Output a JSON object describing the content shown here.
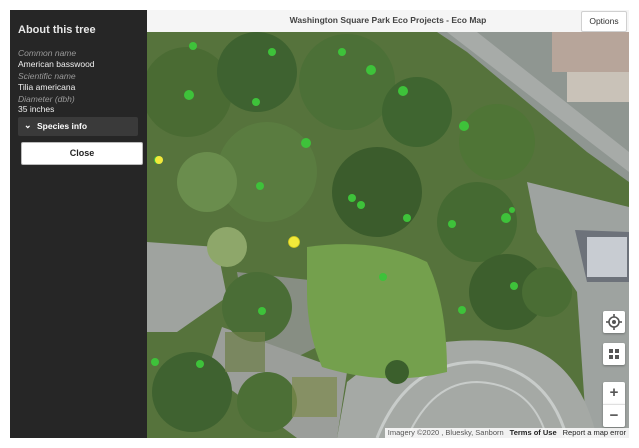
{
  "header": {
    "title": "Washington Square Park Eco Projects - Eco Map",
    "options_label": "Options"
  },
  "sidebar": {
    "title": "About this tree",
    "fields": [
      {
        "label": "Common name",
        "value": "American basswood"
      },
      {
        "label": "Scientific name",
        "value": "Tilia americana"
      },
      {
        "label": "Diameter (dbh)",
        "value": "35 inches"
      }
    ],
    "species_info_label": "Species info",
    "close_label": "Close"
  },
  "map": {
    "attribution": "Imagery ©2020 , Bluesky, Sanborn",
    "terms_label": "Terms of Use",
    "report_label": "Report a map error",
    "tree_marker_color": "#3ec23a",
    "selected_marker_color": "#f2e93a",
    "controls": {
      "locate_icon": "crosshair-icon",
      "layers_icon": "grid-icon",
      "zoom_in": "+",
      "zoom_out": "−"
    }
  }
}
